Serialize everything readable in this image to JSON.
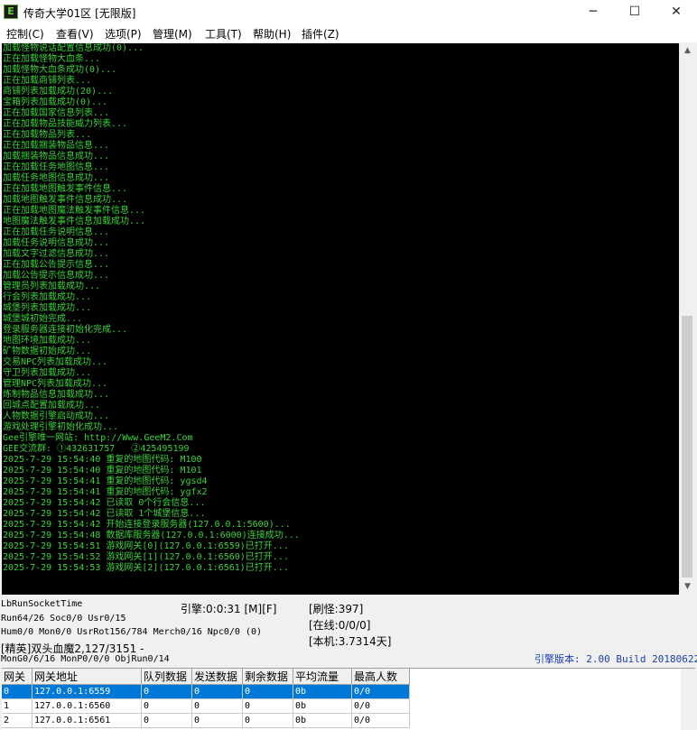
{
  "window": {
    "title": "传奇大学01区 [无限版]",
    "app_icon_letter": "E",
    "minimize_glyph": "─",
    "maximize_glyph": "☐",
    "close_glyph": "✕"
  },
  "menu": [
    {
      "label": "控制(C)"
    },
    {
      "label": "查看(V)"
    },
    {
      "label": "选项(P)"
    },
    {
      "label": "管理(M)"
    },
    {
      "label": "工具(T)"
    },
    {
      "label": "帮助(H)"
    },
    {
      "label": "插件(Z)"
    }
  ],
  "console_lines": [
    "加载怪物说话配置信息成功(0)...",
    "正在加载怪物大血条...",
    "加载怪物大血条成功(0)...",
    "正在加载商铺列表...",
    "商铺列表加载成功(20)...",
    "宝箱列表加载成功(0)...",
    "正在加载国家信息列表...",
    "正在加载物品技能威力列表...",
    "正在加载物品列表...",
    "正在加载捆装物品信息...",
    "加载捆装物品信息成功...",
    "正在加载任务地图信息...",
    "加载任务地图信息成功...",
    "正在加载地图触发事件信息...",
    "加载地图触发事件信息成功...",
    "正在加载地图魔法触发事件信息...",
    "地图魔法触发事件信息加载成功...",
    "正在加载任务说明信息...",
    "加载任务说明信息成功...",
    "加载文字过滤信息成功...",
    "正在加载公告提示信息...",
    "加载公告提示信息成功...",
    "管理员列表加载成功...",
    "行会列表加载成功...",
    "城堡列表加载成功...",
    "城堡城初始完成...",
    "登录服务器连接初始化完成...",
    "地图环境加载成功...",
    "矿物数据初始成功...",
    "交易NPC列表加载成功...",
    "守卫列表加载成功...",
    "管理NPC列表加载成功...",
    "炼制物品信息加载成功...",
    "回城点配置加载成功...",
    "人物数据引擎启动成功...",
    "游戏处理引擎初始化成功...",
    "Gee引擎唯一网站: http://Www.GeeM2.Com",
    "GEE交流群: ①432631757   ②425495199",
    "2025-7-29 15:54:40 重复的地图代码: M100",
    "2025-7-29 15:54:40 重复的地图代码: M101",
    "2025-7-29 15:54:41 重复的地图代码: ygsd4",
    "2025-7-29 15:54:41 重复的地图代码: ygfx2",
    "2025-7-29 15:54:42 已读取 0个行会信息...",
    "2025-7-29 15:54:42 已读取 1个城堡信息...",
    "2025-7-29 15:54:42 开始连接登录服务器(127.0.0.1:5600)...",
    "2025-7-29 15:54:48 数据库服务器(127.0.0.1:6000)连接成功...",
    "2025-7-29 15:54:51 游戏网关[0](127.0.0.1:6559)已打开...",
    "2025-7-29 15:54:52 游戏网关[1](127.0.0.1:6560)已打开...",
    "2025-7-29 15:54:53 游戏网关[2](127.0.0.1:6561)已打开..."
  ],
  "status": {
    "socket_label": "LbRunSocketTime",
    "engine_time": "引擎:0:0:31 [M][F]",
    "refresh_monsters": "[刷怪:397]",
    "run_line": "Run64/26 Soc0/0 Usr0/15",
    "online": "[在线:0/0/0]",
    "hum_line": "Hum0/0 Mon0/0 UsrRot156/784 Merch0/16 Npc0/0 (0)",
    "machine": "[本机:3.7314天]",
    "elite_line": "[精英]双头血魔2,127/3151 -",
    "mon_line": "MonG0/6/16 MonP0/0/0 ObjRun0/14",
    "engine_version": "引擎版本: 2.00 Build 20180622",
    "version_color": "#1a3fb0"
  },
  "gateway_table": {
    "headers": [
      "网关",
      "网关地址",
      "队列数据",
      "发送数据",
      "剩余数据",
      "平均流量",
      "最高人数"
    ],
    "rows": [
      [
        "0",
        "127.0.0.1:6559",
        "0",
        "0",
        "0",
        "0b",
        "0/0"
      ],
      [
        "1",
        "127.0.0.1:6560",
        "0",
        "0",
        "0",
        "0b",
        "0/0"
      ],
      [
        "2",
        "127.0.0.1:6561",
        "0",
        "0",
        "0",
        "0b",
        "0/0"
      ]
    ],
    "selected_row": 0
  },
  "colors": {
    "console_bg": "#000000",
    "console_text": "#3ad23a",
    "selection": "#0078d7"
  }
}
